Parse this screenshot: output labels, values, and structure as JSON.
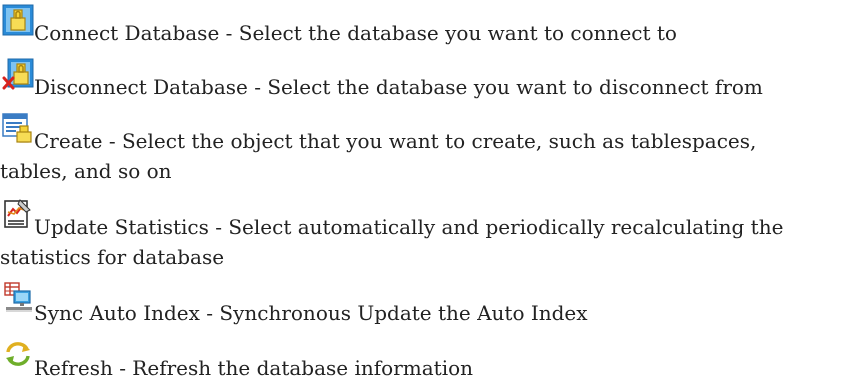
{
  "entries": [
    {
      "icon": "connect-database-icon",
      "text": "Connect Database - Select the database you want to connect to",
      "line2": ""
    },
    {
      "icon": "disconnect-database-icon",
      "text": "Disconnect Database - Select the database you want to disconnect from",
      "line2": ""
    },
    {
      "icon": "create-object-icon",
      "text": "Create - Select the object that you want to create, such as tablespaces,",
      "line2": "tables, and so on"
    },
    {
      "icon": "update-statistics-icon",
      "text": "Update Statistics - Select automatically and periodically recalculating the",
      "line2": "statistics for database"
    },
    {
      "icon": "sync-auto-index-icon",
      "text": "Sync Auto Index - Synchronous Update the Auto Index",
      "line2": ""
    },
    {
      "icon": "refresh-icon",
      "text": "Refresh - Refresh the database information",
      "line2": ""
    }
  ]
}
